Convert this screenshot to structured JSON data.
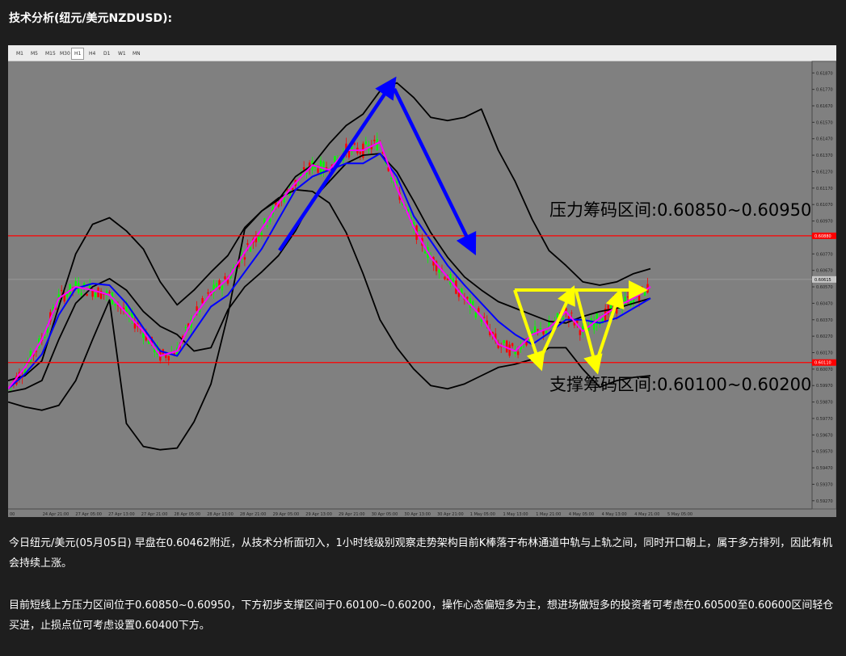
{
  "heading": "技术分析(纽元/美元NZDUSD):",
  "timeframes": [
    "M1",
    "M5",
    "M15",
    "M30",
    "H1",
    "H4",
    "D1",
    "W1",
    "MN"
  ],
  "active_timeframe": "H1",
  "paragraphs": [
    "今日纽元/美元(05月05日) 早盘在0.60462附近，从技术分析面切入，1小时线级别观察走势架构目前K棒落于布林通道中轨与上轨之间，同时开口朝上，属于多方排列，因此有机会持续上涨。",
    "目前短线上方压力区间位于0.60850~0.60950，下方初步支撑区间于0.60100~0.60200，操作心态偏短多为主，想进场做短多的投资者可考虑在0.60500至0.60600区间轻仓买进，止损点位可考虑设置0.60400下方。"
  ],
  "chart_data": {
    "type": "line",
    "symbol": "NZDUSD",
    "timeframe": "H1",
    "ylim": [
      0.5922,
      0.6194
    ],
    "y_ticks": [
      "0.61870",
      "0.61770",
      "0.61670",
      "0.61570",
      "0.61470",
      "0.61370",
      "0.61270",
      "0.61170",
      "0.61070",
      "0.60970",
      "0.60870",
      "0.60770",
      "0.60670",
      "0.60570",
      "0.60470",
      "0.60370",
      "0.60270",
      "0.60170",
      "0.60070",
      "0.59970",
      "0.59870",
      "0.59770",
      "0.59670",
      "0.59570",
      "0.59470",
      "0.59370",
      "0.59270"
    ],
    "x_ticks": [
      "00",
      "24 Apr 21:00",
      "27 Apr 05:00",
      "27 Apr 13:00",
      "27 Apr 21:00",
      "28 Apr 05:00",
      "28 Apr 13:00",
      "28 Apr 21:00",
      "29 Apr 05:00",
      "29 Apr 13:00",
      "29 Apr 21:00",
      "30 Apr 05:00",
      "30 Apr 13:00",
      "30 Apr 21:00",
      "1 May 05:00",
      "1 May 13:00",
      "1 May 21:00",
      "4 May 05:00",
      "4 May 13:00",
      "4 May 21:00",
      "5 May 05:00"
    ],
    "current_price": "0.60615",
    "resistance_line": {
      "value": 0.6088,
      "label": "0.60880",
      "color": "#ff0000"
    },
    "support_line": {
      "value": 0.6011,
      "label": "0.60110",
      "color": "#ff0000"
    },
    "annotations": {
      "resistance_text": "压力筹码区间:0.60850~0.60950",
      "support_text": "支撑筹码区间:0.60100~0.60200"
    },
    "series": [
      {
        "name": "",
        "color": "#000000",
        "values": [
          0.6,
          0.6003,
          0.6012,
          0.6045,
          0.6077,
          0.6095,
          0.6099,
          0.6091,
          0.608,
          0.606,
          0.6046,
          0.6055,
          0.6066,
          0.6076,
          0.6093,
          0.6103,
          0.611,
          0.6124,
          0.6131,
          0.6144,
          0.6155,
          0.6162,
          0.6176,
          0.6181,
          0.6172,
          0.616,
          0.6158,
          0.616,
          0.6165,
          0.614,
          0.6121,
          0.6098,
          0.6079,
          0.607,
          0.606,
          0.6058,
          0.606,
          0.6065,
          0.6068
        ]
      },
      {
        "name": "",
        "color": "#000000",
        "values": [
          0.5987,
          0.5984,
          0.5982,
          0.5985,
          0.6,
          0.6025,
          0.6049,
          0.5974,
          0.596,
          0.5958,
          0.5959,
          0.5975,
          0.5998,
          0.604,
          0.6092,
          0.6103,
          0.6111,
          0.6116,
          0.6115,
          0.6108,
          0.609,
          0.6065,
          0.6037,
          0.602,
          0.6007,
          0.5997,
          0.5995,
          0.5998,
          0.6003,
          0.6008,
          0.601,
          0.6013,
          0.602,
          0.602,
          0.6007,
          0.5996,
          0.6,
          0.6002,
          0.6003
        ]
      },
      {
        "name": "",
        "color": "#000000",
        "values": [
          0.5993,
          0.5995,
          0.6,
          0.6025,
          0.6047,
          0.6057,
          0.6062,
          0.6055,
          0.6042,
          0.6033,
          0.6028,
          0.6018,
          0.602,
          0.6043,
          0.6057,
          0.6066,
          0.6076,
          0.6091,
          0.611,
          0.6121,
          0.6132,
          0.6137,
          0.6138,
          0.6127,
          0.6109,
          0.609,
          0.6075,
          0.6063,
          0.6055,
          0.6048,
          0.6044,
          0.604,
          0.6036,
          0.6035,
          0.6039,
          0.6042,
          0.6044,
          0.6047,
          0.605
        ]
      },
      {
        "name": "",
        "color": "#0000ff",
        "values": [
          0.5995,
          0.6004,
          0.6016,
          0.604,
          0.6056,
          0.6059,
          0.6058,
          0.6047,
          0.6032,
          0.6018,
          0.6015,
          0.603,
          0.6045,
          0.6052,
          0.6066,
          0.608,
          0.6098,
          0.6116,
          0.6124,
          0.6128,
          0.6132,
          0.6132,
          0.6138,
          0.6124,
          0.61,
          0.6085,
          0.607,
          0.6058,
          0.6047,
          0.6036,
          0.6028,
          0.6022,
          0.6029,
          0.6037,
          0.6037,
          0.6035,
          0.6038,
          0.6044,
          0.605
        ]
      },
      {
        "name": "",
        "color": "#ff00ff",
        "values": [
          0.5995,
          0.6008,
          0.6025,
          0.605,
          0.6057,
          0.6055,
          0.6052,
          0.6041,
          0.603,
          0.6015,
          0.6018,
          0.6039,
          0.6053,
          0.6062,
          0.6078,
          0.6092,
          0.6108,
          0.612,
          0.6131,
          0.6128,
          0.614,
          0.614,
          0.6145,
          0.6117,
          0.6093,
          0.6075,
          0.6063,
          0.605,
          0.6039,
          0.6022,
          0.6018,
          0.6028,
          0.6032,
          0.6042,
          0.603,
          0.6038,
          0.6045,
          0.605,
          0.6057
        ]
      }
    ]
  }
}
